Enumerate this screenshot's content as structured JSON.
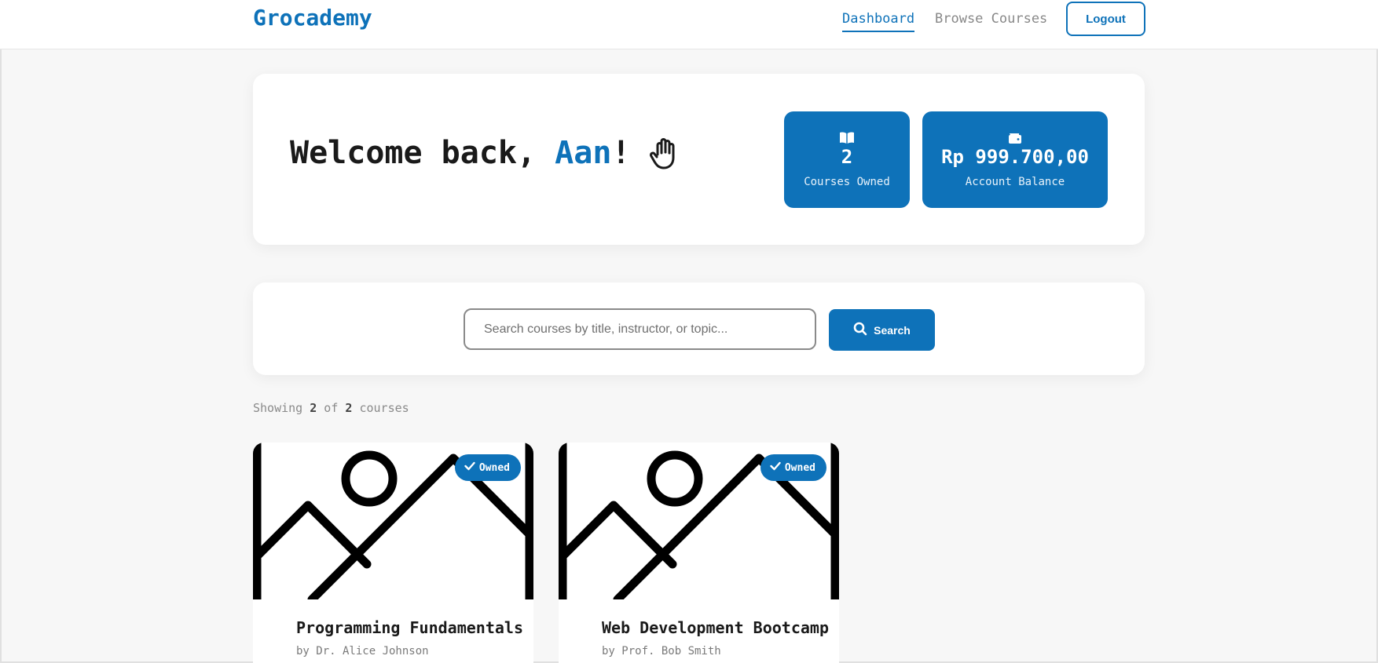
{
  "header": {
    "brand": "Grocademy",
    "nav": [
      {
        "label": "Dashboard",
        "active": true
      },
      {
        "label": "Browse Courses",
        "active": false
      }
    ],
    "logout_label": "Logout"
  },
  "welcome": {
    "greeting_prefix": "Welcome back, ",
    "user_name": "Aan",
    "greeting_suffix": "!",
    "icon": "waving-hand-icon"
  },
  "stats": {
    "courses_owned": {
      "value": "2",
      "label": "Courses Owned",
      "icon": "book-open-icon"
    },
    "balance": {
      "value": "Rp 999.700,00",
      "label": "Account Balance",
      "icon": "wallet-icon"
    }
  },
  "search": {
    "value": "",
    "placeholder": "Search courses by title, instructor, or topic...",
    "button_label": "Search"
  },
  "results": {
    "prefix": "Showing ",
    "shown": "2",
    "middle": " of ",
    "total": "2",
    "suffix": " courses"
  },
  "courses": [
    {
      "title": "Programming Fundamentals",
      "instructor": "by Dr. Alice Johnson",
      "badge": "Owned"
    },
    {
      "title": "Web Development Bootcamp",
      "instructor": "by Prof. Bob Smith",
      "badge": "Owned"
    }
  ],
  "colors": {
    "accent": "#0e72b9",
    "background": "#f7f7f7",
    "card": "#ffffff"
  }
}
